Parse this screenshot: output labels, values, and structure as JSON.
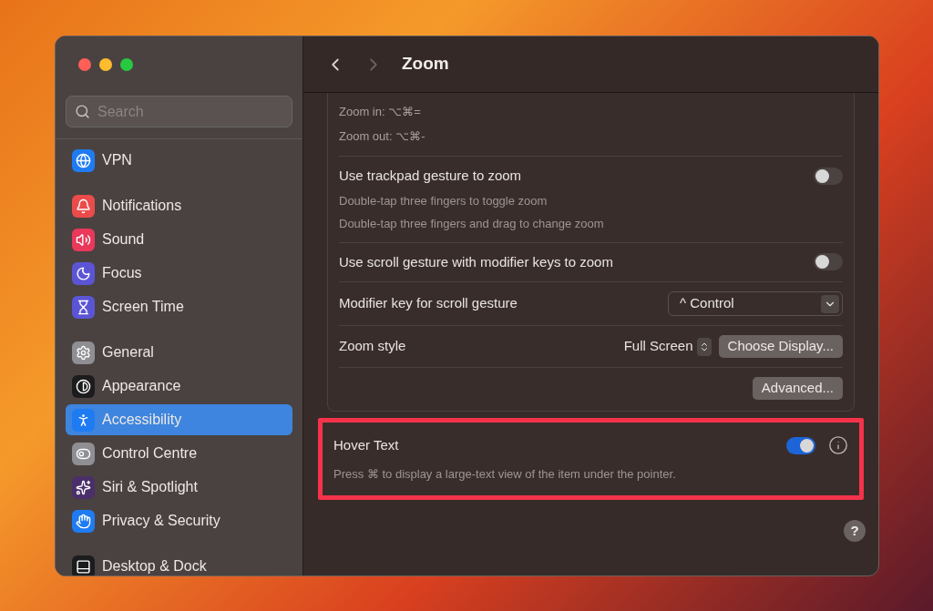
{
  "sidebar": {
    "search": {
      "placeholder": "Search"
    },
    "groups": [
      [
        {
          "label": "VPN",
          "kind": "globe",
          "color": "#1f7bf2",
          "selected": false
        }
      ],
      [
        {
          "label": "Notifications",
          "kind": "bell",
          "color": "#eb4b4b",
          "selected": false
        },
        {
          "label": "Sound",
          "kind": "sound",
          "color": "#e9385a",
          "selected": false
        },
        {
          "label": "Focus",
          "kind": "moon",
          "color": "#5b55d6",
          "selected": false
        },
        {
          "label": "Screen Time",
          "kind": "hourglass",
          "color": "#5b55d6",
          "selected": false
        }
      ],
      [
        {
          "label": "General",
          "kind": "gear",
          "color": "#8e8e93",
          "selected": false
        },
        {
          "label": "Appearance",
          "kind": "appearance",
          "color": "#1c1c1e",
          "selected": false
        },
        {
          "label": "Accessibility",
          "kind": "accessibility",
          "color": "#1f7bf2",
          "selected": true
        },
        {
          "label": "Control Centre",
          "kind": "toggles",
          "color": "#8e8e93",
          "selected": false
        },
        {
          "label": "Siri & Spotlight",
          "kind": "siri",
          "color": "#4b2f6b",
          "selected": false
        },
        {
          "label": "Privacy & Security",
          "kind": "hand",
          "color": "#1f7bf2",
          "selected": false
        }
      ],
      [
        {
          "label": "Desktop & Dock",
          "kind": "dock",
          "color": "#1c1c1e",
          "selected": false
        }
      ]
    ]
  },
  "header": {
    "title": "Zoom"
  },
  "zoom_card": {
    "shortcuts": [
      "Zoom in: ⌥⌘=",
      "Zoom out: ⌥⌘-"
    ],
    "rows": [
      {
        "kind": "toggle",
        "label": "Use trackpad gesture to zoom",
        "on": false,
        "notes": [
          "Double-tap three fingers to toggle zoom",
          "Double-tap three fingers and drag to change zoom"
        ]
      },
      {
        "kind": "toggle",
        "label": "Use scroll gesture with modifier keys to zoom",
        "on": false
      },
      {
        "kind": "select",
        "label": "Modifier key for scroll gesture",
        "value": "^ Control"
      },
      {
        "kind": "stepper",
        "label": "Zoom style",
        "value": "Full Screen",
        "button": "Choose Display..."
      },
      {
        "kind": "button",
        "button": "Advanced..."
      }
    ]
  },
  "hover_card": {
    "label": "Hover Text",
    "on": true,
    "note": "Press ⌘ to display a large-text view of the item under the pointer.",
    "highlighted": true
  },
  "help": "?"
}
